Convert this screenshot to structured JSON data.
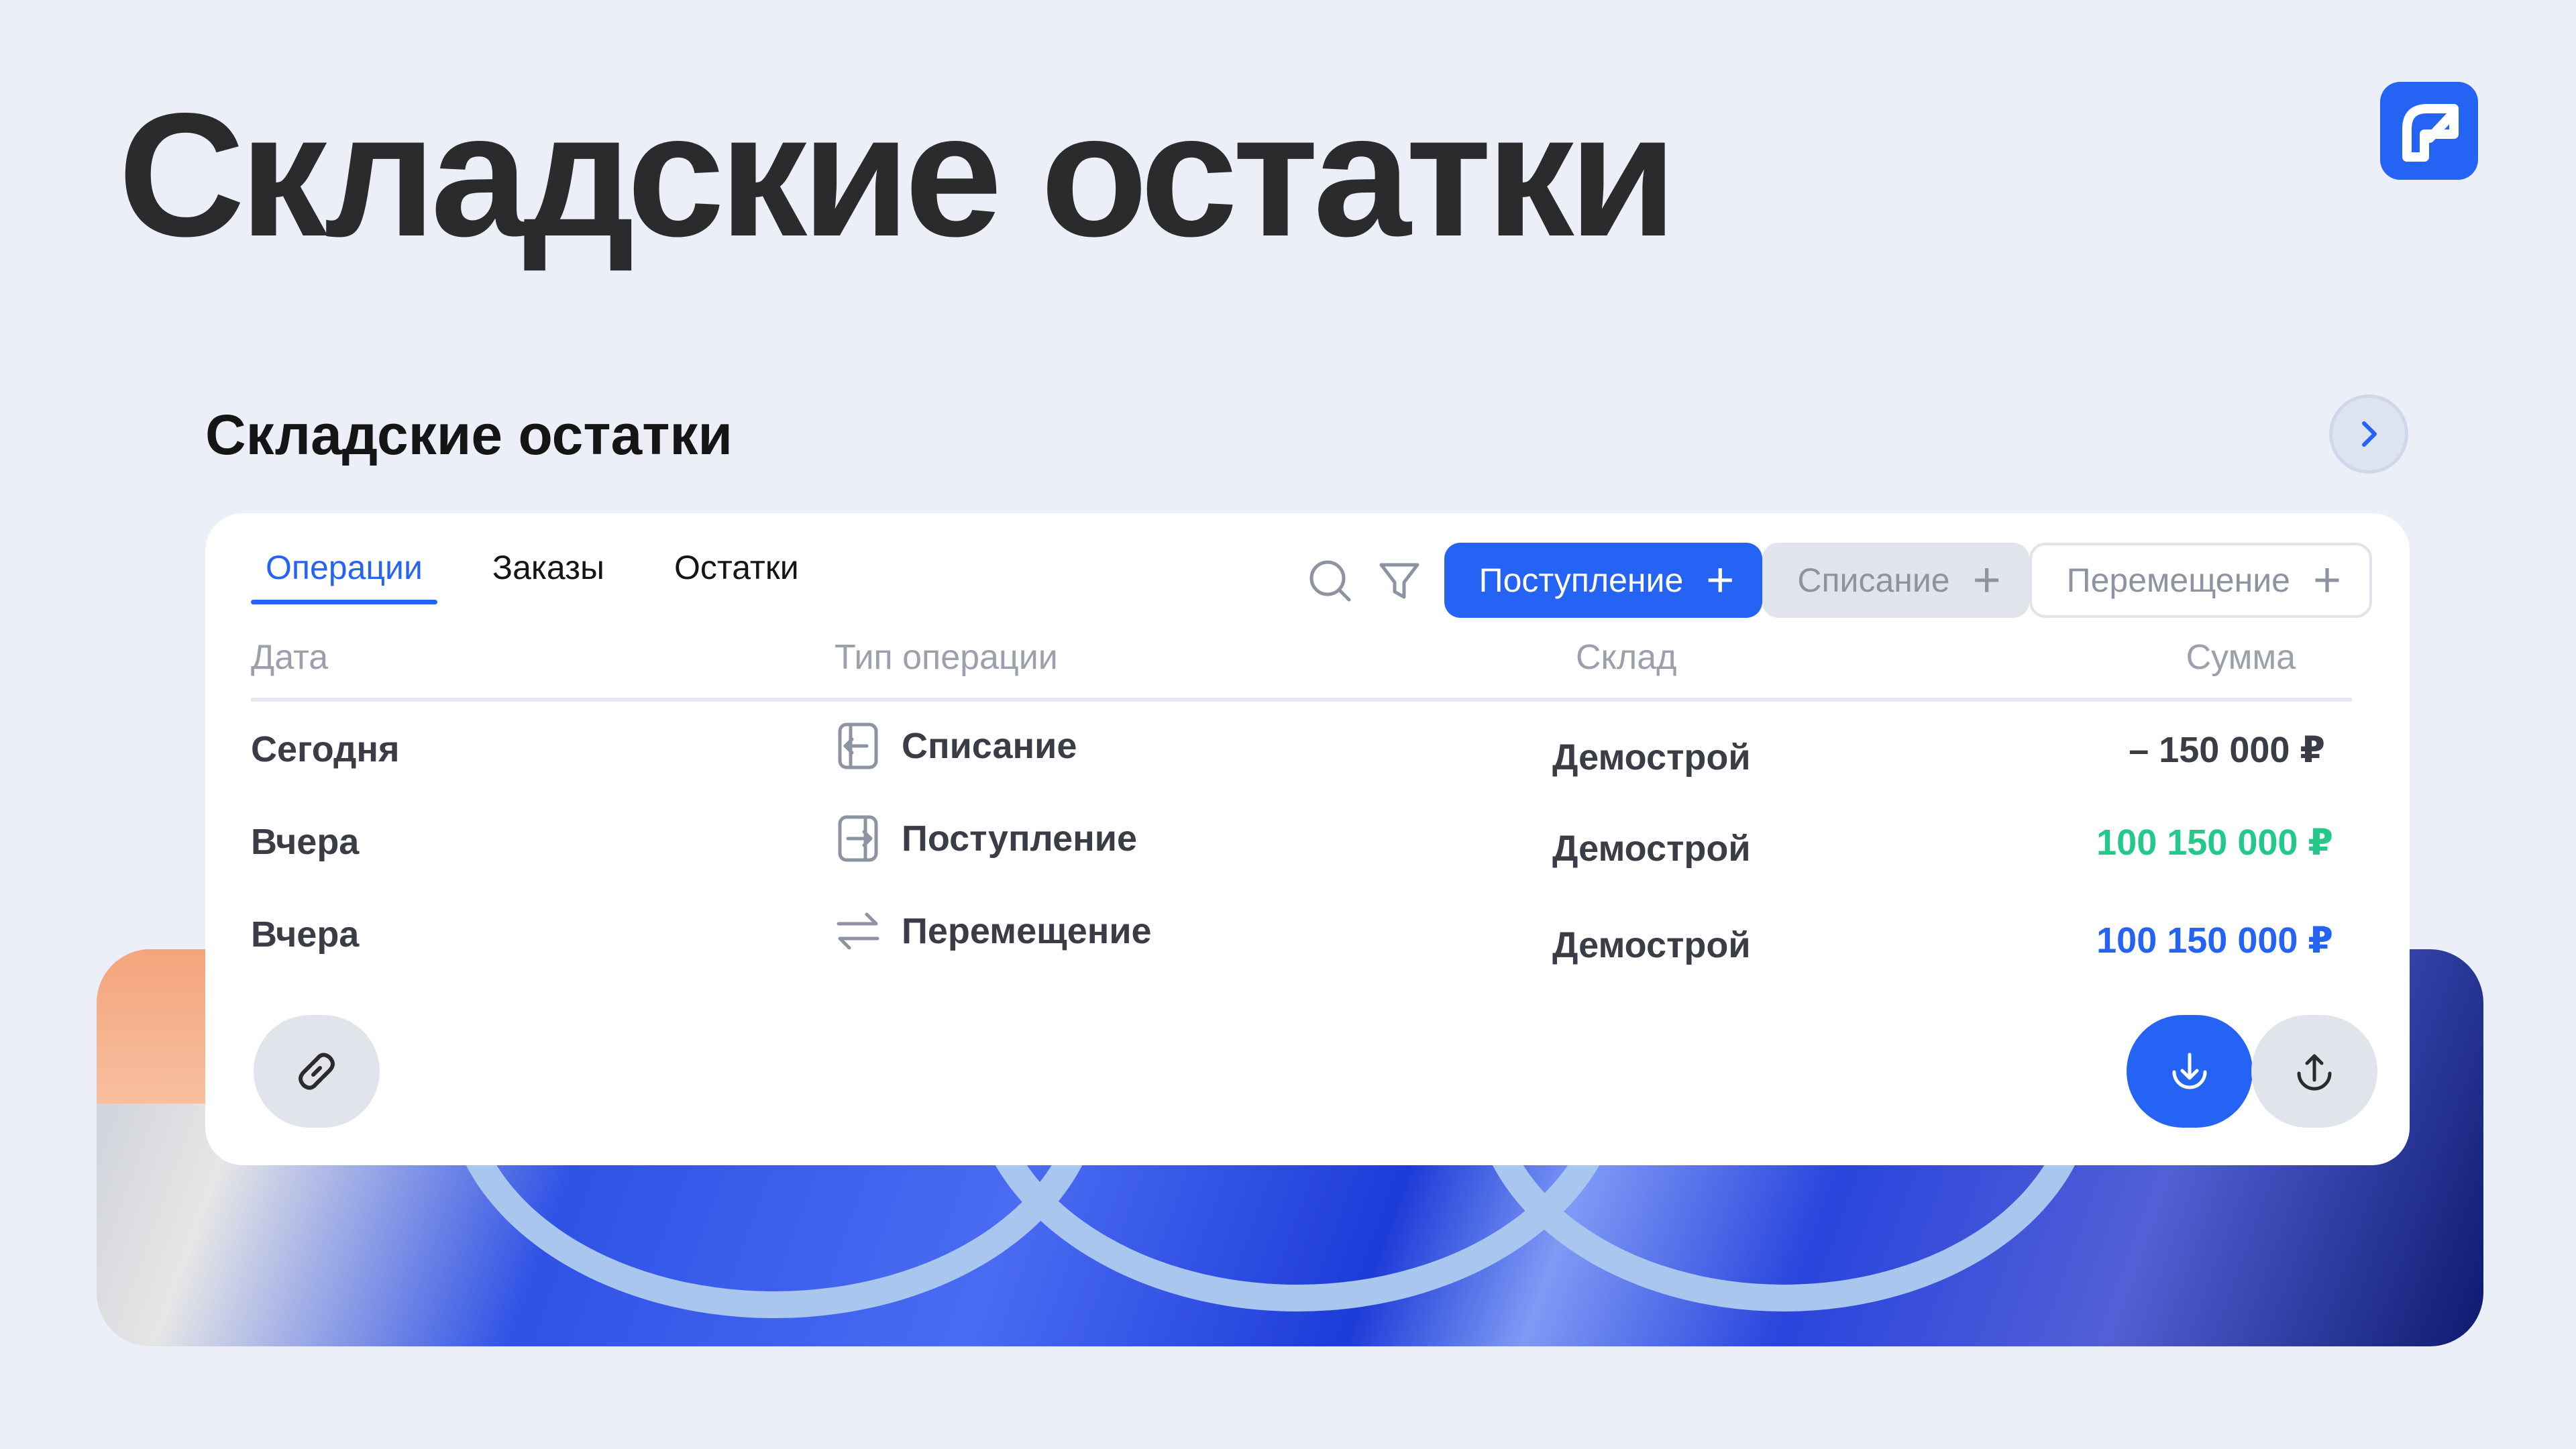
{
  "hero": {
    "title": "Складские остатки"
  },
  "logo": {
    "name": "brand-logo-icon",
    "color": "#2563f5"
  },
  "section": {
    "title": "Складские остатки",
    "next_icon": "chevron-right-icon"
  },
  "tabs": [
    {
      "label": "Операции",
      "active": true
    },
    {
      "label": "Заказы",
      "active": false
    },
    {
      "label": "Остатки",
      "active": false
    }
  ],
  "toolbar": {
    "search_icon": "search-icon",
    "filter_icon": "filter-icon",
    "buttons": [
      {
        "label": "Поступление",
        "style": "primary"
      },
      {
        "label": "Списание",
        "style": "gray"
      },
      {
        "label": "Перемещение",
        "style": "outline"
      }
    ]
  },
  "table": {
    "headers": [
      "Дата",
      "Тип операции",
      "Склад",
      "Сумма"
    ],
    "rows": [
      {
        "date": "Сегодня",
        "type": "Списание",
        "icon": "write-off-icon",
        "warehouse": "Демострой",
        "amount": "– 150 000 ₽",
        "amount_color": "#3a3d45"
      },
      {
        "date": "Вчера",
        "type": "Поступление",
        "icon": "receipt-icon",
        "warehouse": "Демострой",
        "amount": "100 150 000 ₽",
        "amount_color": "#24c98a"
      },
      {
        "date": "Вчера",
        "type": "Перемещение",
        "icon": "transfer-icon",
        "warehouse": "Демострой",
        "amount": "100 150 000 ₽",
        "amount_color": "#2563f5"
      }
    ]
  },
  "actions": {
    "link_icon": "link-icon",
    "download_icon": "download-icon",
    "upload_icon": "upload-icon"
  },
  "colors": {
    "accent": "#2563f5",
    "background": "#eceff7",
    "success": "#24c98a"
  }
}
